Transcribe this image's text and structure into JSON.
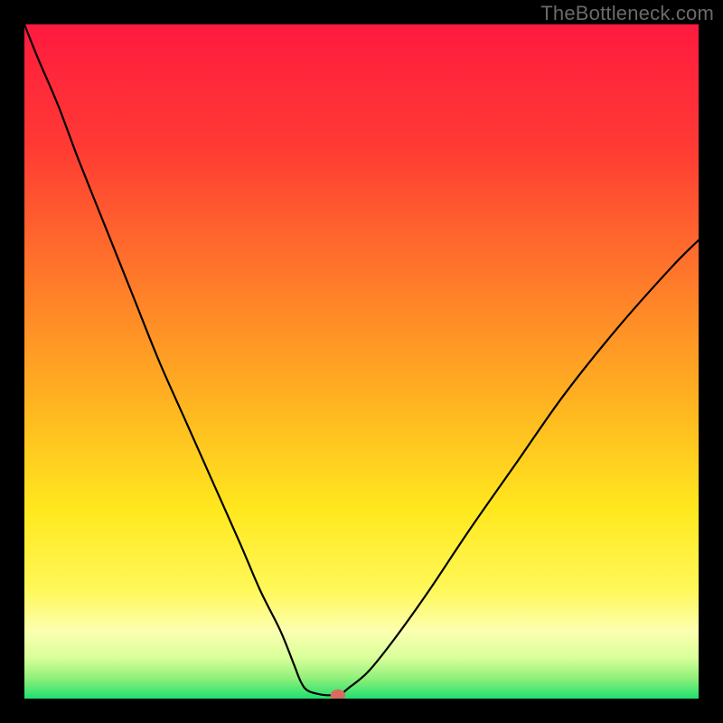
{
  "watermark": "TheBottleneck.com",
  "chart_data": {
    "type": "line",
    "title": "",
    "xlabel": "",
    "ylabel": "",
    "xlim": [
      0,
      100
    ],
    "ylim": [
      0,
      100
    ],
    "gradient_stops": [
      {
        "offset": 0.0,
        "color": "#ff1a3f"
      },
      {
        "offset": 0.18,
        "color": "#ff3a34"
      },
      {
        "offset": 0.38,
        "color": "#ff7a2a"
      },
      {
        "offset": 0.55,
        "color": "#ffb021"
      },
      {
        "offset": 0.72,
        "color": "#ffe81e"
      },
      {
        "offset": 0.84,
        "color": "#fff85a"
      },
      {
        "offset": 0.9,
        "color": "#fcffb0"
      },
      {
        "offset": 0.94,
        "color": "#d8ff9a"
      },
      {
        "offset": 0.97,
        "color": "#8ff07a"
      },
      {
        "offset": 1.0,
        "color": "#20e070"
      }
    ],
    "series": [
      {
        "name": "bottleneck-curve",
        "color": "#000000",
        "x": [
          0,
          2,
          5,
          8,
          12,
          16,
          20,
          24,
          28,
          32,
          35,
          38,
          40,
          41,
          42,
          44,
          46,
          47,
          48,
          51,
          55,
          60,
          66,
          73,
          80,
          88,
          96,
          100
        ],
        "y": [
          100,
          95,
          88,
          80,
          70,
          60,
          50,
          41,
          32,
          23,
          16,
          10,
          5,
          2.5,
          1.2,
          0.6,
          0.5,
          0.7,
          1.5,
          4,
          9,
          16,
          25,
          35,
          45,
          55,
          64,
          68
        ]
      }
    ],
    "marker": {
      "x": 46.5,
      "y": 0.5,
      "rx": 1.1,
      "ry": 0.85,
      "color": "#d96a5e"
    }
  }
}
